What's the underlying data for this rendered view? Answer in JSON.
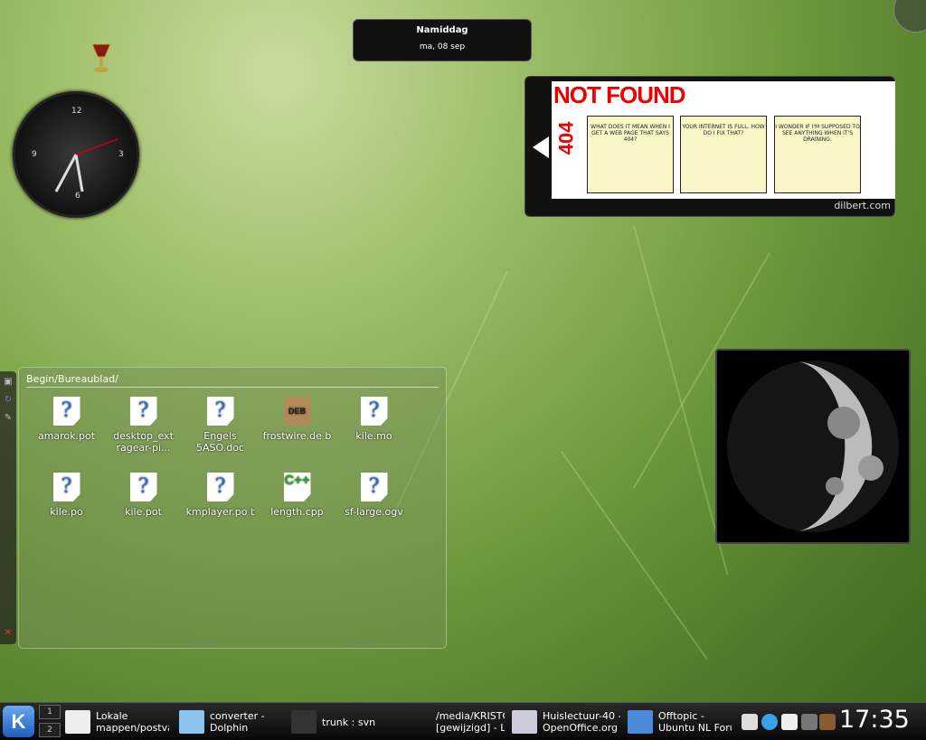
{
  "date_widget": {
    "title": "Namiddag",
    "date": "ma, 08 sep"
  },
  "clock": {
    "numerals": [
      "12",
      "3",
      "6",
      "9"
    ]
  },
  "comic": {
    "header": "NOT FOUND",
    "code": "404",
    "panels": [
      "WHAT DOES IT MEAN WHEN I GET A WEB PAGE THAT SAYS 404?",
      "YOUR INTERNET IS FULL.   HOW DO I FIX THAT?",
      "I WONDER IF I'M SUPPOSED TO SEE ANYTHING WHEN IT'S DRAINING."
    ],
    "source": "dilbert.com"
  },
  "folder_view": {
    "path": "Begin/Bureaublad/",
    "files": [
      {
        "name": "amarok.pot",
        "icon": "unknown"
      },
      {
        "name": "desktop_ext ragear-pi...",
        "icon": "unknown"
      },
      {
        "name": "Engels 5ASO.doc",
        "icon": "unknown"
      },
      {
        "name": "frostwire.de b",
        "icon": "deb"
      },
      {
        "name": "kile.mo",
        "icon": "unknown"
      },
      {
        "name": "kile.po",
        "icon": "unknown"
      },
      {
        "name": "kile.pot",
        "icon": "unknown"
      },
      {
        "name": "kmplayer.po t",
        "icon": "unknown"
      },
      {
        "name": "length.cpp",
        "icon": "cpp"
      },
      {
        "name": "sf-large.ogv",
        "icon": "unknown"
      }
    ]
  },
  "taskbar": {
    "pager": [
      "1",
      "2"
    ],
    "tasks": [
      {
        "line1": "Lokale",
        "line2": "mappen/postva"
      },
      {
        "line1": "converter -",
        "line2": "Dolphin"
      },
      {
        "line1": "trunk : svn",
        "line2": ""
      },
      {
        "line1": "/media/KRISTOF",
        "line2": "[gewijzigd] - Lo"
      },
      {
        "line1": "Huislectuur-40 -",
        "line2": "OpenOffice.org Wri"
      },
      {
        "line1": "Offtopic -",
        "line2": "Ubuntu NL Forum"
      }
    ],
    "clock": "17:35"
  }
}
